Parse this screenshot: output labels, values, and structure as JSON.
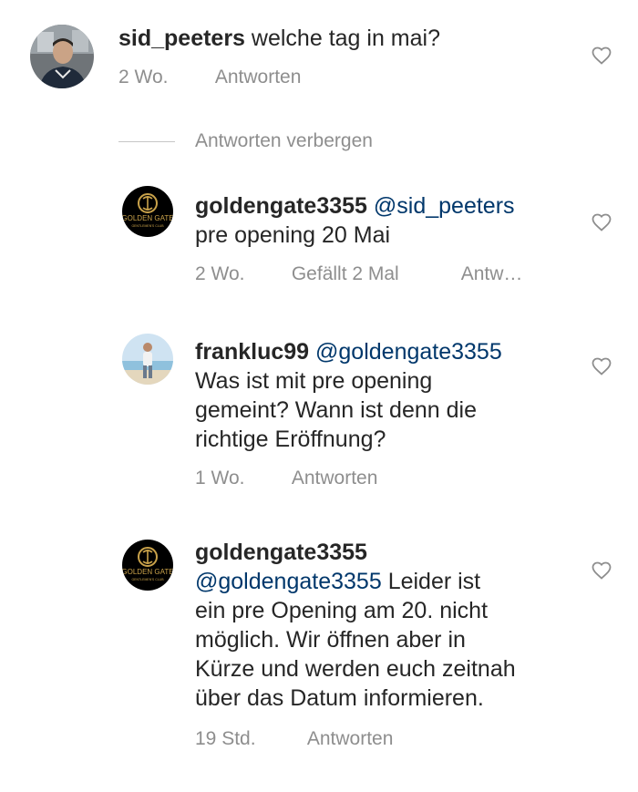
{
  "comments": [
    {
      "username": "sid_peeters",
      "mention": "",
      "text": "welche tag in mai?",
      "time": "2 Wo.",
      "likes": "",
      "reply_label": "Antworten"
    },
    {
      "username": "goldengate3355",
      "mention": "@sid_peeters",
      "text": "pre opening 20 Mai",
      "time": "2 Wo.",
      "likes": "Gefällt 2 Mal",
      "reply_label": "Antw…",
      "avatar_text_top": "GOLDEN GATE",
      "avatar_text_bottom": "GENTLEMEN'S CLUB"
    },
    {
      "username": "frankluc99",
      "mention": "@goldengate3355",
      "text_lines": [
        "Was ist mit pre opening",
        "gemeint? Wann ist denn die",
        "richtige Eröffnung?"
      ],
      "time": "1 Wo.",
      "likes": "",
      "reply_label": "Antworten"
    },
    {
      "username": "goldengate3355",
      "mention": "@goldengate3355",
      "text_first": "Leider ist",
      "text_lines": [
        "ein pre Opening am 20. nicht",
        "möglich. Wir öffnen aber in",
        "Kürze und werden euch zeitnah",
        "über das Datum informieren."
      ],
      "time": "19 Std.",
      "likes": "",
      "reply_label": "Antworten",
      "avatar_text_top": "GOLDEN GATE",
      "avatar_text_bottom": "GENTLEMEN'S CLUB"
    }
  ],
  "hide_replies_label": "Antworten verbergen",
  "colors": {
    "text": "#262626",
    "secondary": "#8e8e8e",
    "mention": "#00376b",
    "gold": "#c9a24a"
  },
  "icons": {
    "like": "heart-outline-icon"
  }
}
